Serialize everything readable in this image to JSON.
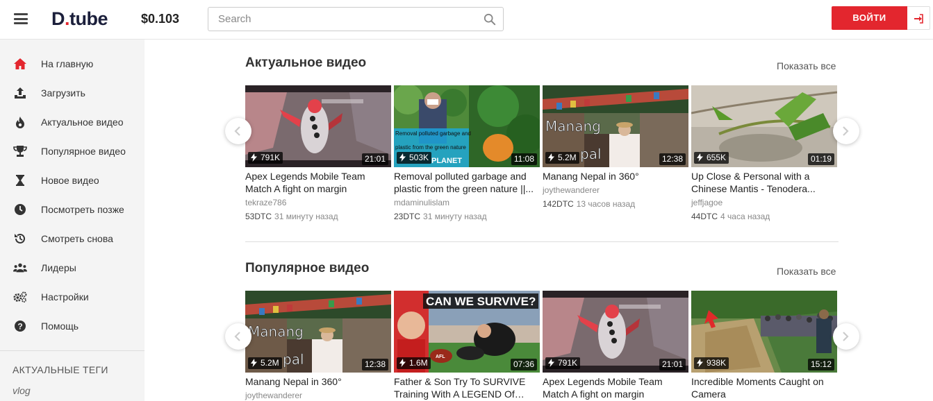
{
  "header": {
    "logo_main": "D",
    "logo_dot": ".",
    "logo_rest": "tube",
    "balance": "$0.103",
    "search_placeholder": "Search",
    "login_label": "ВОЙТИ",
    "accent_color": "#e3262e"
  },
  "sidebar": {
    "items": [
      {
        "label": "На главную",
        "icon": "home-icon"
      },
      {
        "label": "Загрузить",
        "icon": "upload-icon"
      },
      {
        "label": "Актуальное видео",
        "icon": "flame-icon"
      },
      {
        "label": "Популярное видео",
        "icon": "trophy-icon"
      },
      {
        "label": "Новое видео",
        "icon": "hourglass-icon"
      },
      {
        "label": "Посмотреть позже",
        "icon": "clock-icon"
      },
      {
        "label": "Смотреть снова",
        "icon": "history-icon"
      },
      {
        "label": "Лидеры",
        "icon": "users-icon"
      },
      {
        "label": "Настройки",
        "icon": "cogs-icon"
      },
      {
        "label": "Помощь",
        "icon": "help-icon"
      }
    ],
    "tags_title": "АКТУАЛЬНЫЕ ТЕГИ",
    "tags": [
      "vlog"
    ]
  },
  "sections": [
    {
      "title": "Актуальное видео",
      "show_all": "Показать все",
      "videos": [
        {
          "title": "Apex Legends Mobile Team Match A fight on margin",
          "author": "tekraze786",
          "dtc": "53DTC",
          "ago": "31 минуту назад",
          "views": "791K",
          "duration": "21:01"
        },
        {
          "title": "Removal polluted garbage and plastic from the green nature ||...",
          "author": "mdaminulislam",
          "dtc": "23DTC",
          "ago": "31 минуту назад",
          "views": "503K",
          "duration": "11:08"
        },
        {
          "title": "Manang Nepal in 360°",
          "author": "joythewanderer",
          "dtc": "142DTC",
          "ago": "13 часов назад",
          "views": "5.2M",
          "duration": "12:38"
        },
        {
          "title": "Up Close & Personal with a Chinese Mantis - Tenodera...",
          "author": "jeffjagoe",
          "dtc": "44DTC",
          "ago": "4 часа назад",
          "views": "655K",
          "duration": "01:19"
        }
      ]
    },
    {
      "title": "Популярное видео",
      "show_all": "Показать все",
      "videos": [
        {
          "title": "Manang Nepal in 360°",
          "author": "joythewanderer",
          "views": "5.2M",
          "duration": "12:38"
        },
        {
          "title": "Father & Son Try To SURVIVE Training With A LEGEND Of AFL...",
          "author": "",
          "views": "1.6M",
          "duration": "07:36"
        },
        {
          "title": "Apex Legends Mobile Team Match A fight on margin",
          "author": "",
          "views": "791K",
          "duration": "21:01"
        },
        {
          "title": "Incredible Moments Caught on Camera",
          "author": "",
          "views": "938K",
          "duration": "15:12"
        }
      ]
    }
  ],
  "thumb_text": {
    "garbage_overlay_1": "Removal polluted garbage and",
    "garbage_overlay_2": "plastic from the green nature",
    "garbage_overlay_3": "PLANET",
    "manang_overlay_1": "Manang",
    "manang_overlay_2": "pal",
    "survive_overlay": "CAN WE SURVIVE?",
    "afl_logo": "AFL"
  }
}
